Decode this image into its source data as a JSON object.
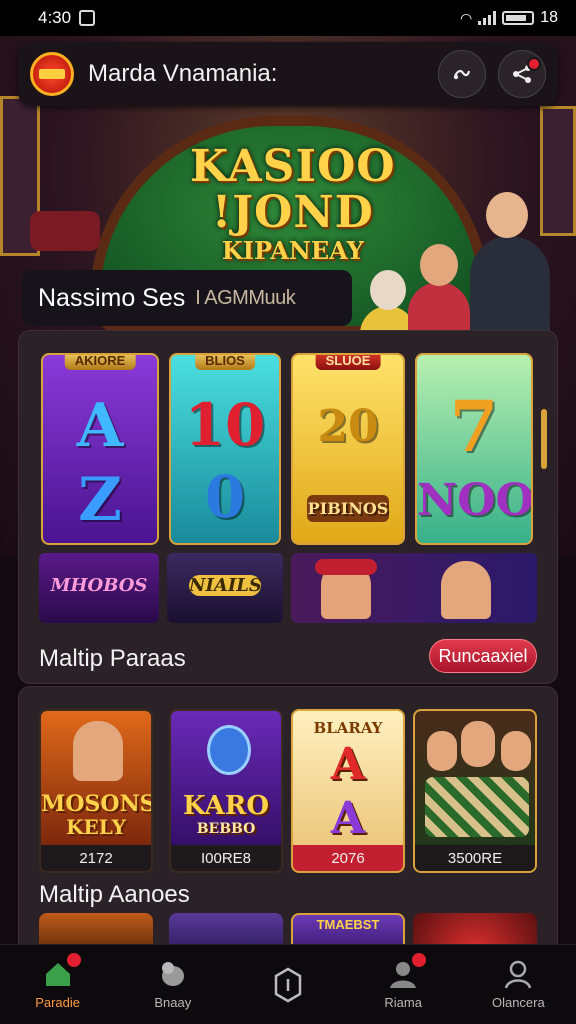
{
  "status": {
    "time": "4:30",
    "battery_text": "18"
  },
  "header": {
    "title": "Marda Vnamania:"
  },
  "hero": {
    "title_line1": "KASIOO",
    "title_line2": "!JOND",
    "title_line3": "KIPANEAY"
  },
  "section1": {
    "title": "Nassimo Ses",
    "subtitle": "I AGMMuuk",
    "tiles": [
      {
        "tag": "AKIORE",
        "top": "A",
        "bottom": "Z"
      },
      {
        "tag": "BLIOS",
        "top": "10",
        "bottom": "0"
      },
      {
        "tag": "SLUOE",
        "top": "20",
        "bottom": "PIBINOS"
      },
      {
        "tag": "",
        "top": "7",
        "bottom": "NOO"
      }
    ],
    "banners": [
      "MHOBOS",
      "NIAILS",
      "",
      ""
    ],
    "row_label": "Maltip Paraas",
    "cta_label": "Runcaaxiel"
  },
  "section2": {
    "games": [
      {
        "name_line1": "MOSONS",
        "name_line2": "KELY",
        "caption": "2172"
      },
      {
        "name_line1": "KARO",
        "name_line2": "BEBBO",
        "caption": "I00RE8"
      },
      {
        "name_line1": "BLARAY",
        "name_line2": "A",
        "caption": "2076"
      },
      {
        "name_line1": "",
        "name_line2": "",
        "caption": "3500RE"
      }
    ],
    "row_label": "Maltip Aanoes",
    "peek_label": "TMAEBST"
  },
  "nav": {
    "items": [
      {
        "label": "Paradie"
      },
      {
        "label": "Bnaay"
      },
      {
        "label": ""
      },
      {
        "label": "Riama"
      },
      {
        "label": "Olancera"
      }
    ]
  },
  "colors": {
    "accent": "#e02030",
    "gold": "#ffd24a",
    "felt": "#2f8a3a",
    "active_nav": "#ff9a40"
  }
}
